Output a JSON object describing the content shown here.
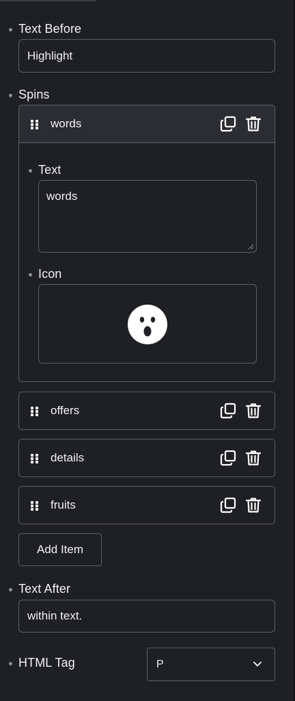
{
  "fields": {
    "text_before": {
      "label": "Text Before",
      "value": "Highlight"
    },
    "spins": {
      "label": "Spins",
      "items": [
        {
          "title": "words",
          "text_label": "Text",
          "text_value": "words",
          "icon_label": "Icon",
          "icon": "surprised-face-icon"
        },
        {
          "title": "offers"
        },
        {
          "title": "details"
        },
        {
          "title": "fruits"
        }
      ],
      "add_label": "Add Item"
    },
    "text_after": {
      "label": "Text After",
      "value": "within text."
    },
    "html_tag": {
      "label": "HTML Tag",
      "value": "P"
    }
  },
  "icons": {
    "drag": "drag-handle-icon",
    "duplicate": "copy-icon",
    "delete": "trash-icon",
    "dropdown": "chevron-down-icon"
  },
  "colors": {
    "background": "#1f2023",
    "border": "#5d6068",
    "active_header": "#2b2d32",
    "text": "#f2f2f2",
    "bullet": "#8c8f96"
  }
}
